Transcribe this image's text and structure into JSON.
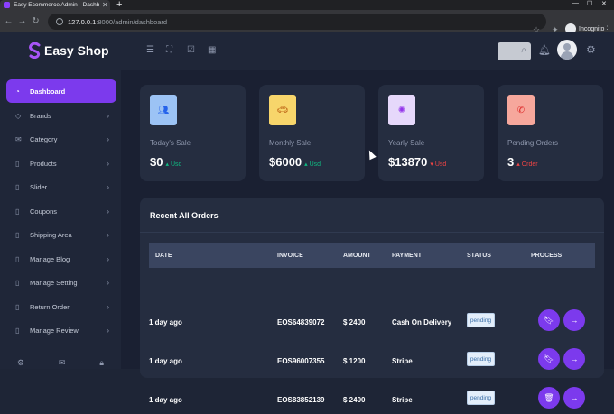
{
  "browser": {
    "tab_title": "Easy Ecommerce Admin - Dashb",
    "tab_close": "✕",
    "new_tab": "+",
    "url_host": "127.0.0.1",
    "url_path": ":8000/admin/dashboard",
    "incognito_label": "Incognito"
  },
  "app": {
    "brand": "Easy Shop",
    "accent": "#7c3aed"
  },
  "topbar_icons": [
    "menu-icon",
    "fullscreen-icon",
    "checkbox-icon",
    "calendar-icon",
    "search-icon",
    "bell-icon",
    "avatar",
    "gear-icon"
  ],
  "sidebar": {
    "items": [
      {
        "label": "Dashboard",
        "icon": "pie-chart-icon",
        "active": true
      },
      {
        "label": "Brands",
        "icon": "tag-icon"
      },
      {
        "label": "Category",
        "icon": "mail-icon"
      },
      {
        "label": "Products",
        "icon": "file-icon"
      },
      {
        "label": "Slider",
        "icon": "file-icon"
      },
      {
        "label": "Coupons",
        "icon": "file-icon"
      },
      {
        "label": "Shipping Area",
        "icon": "file-icon"
      },
      {
        "label": "Manage Blog",
        "icon": "file-icon"
      },
      {
        "label": "Manage Setting",
        "icon": "file-icon"
      },
      {
        "label": "Return Order",
        "icon": "file-icon"
      },
      {
        "label": "Manage Review",
        "icon": "file-icon"
      }
    ]
  },
  "stats": [
    {
      "label": "Today's Sale",
      "value": "$0",
      "trend": "Usd",
      "direction": "up",
      "icon": "users-icon",
      "color": "#9cc3f5"
    },
    {
      "label": "Monthly Sale",
      "value": "$6000",
      "trend": "Usd",
      "direction": "up",
      "icon": "car-icon",
      "color": "#f7d56b"
    },
    {
      "label": "Yearly Sale",
      "value": "$13870",
      "trend": "Usd",
      "direction": "down",
      "icon": "globe-icon",
      "color": "#e6d8fb"
    },
    {
      "label": "Pending Orders",
      "value": "3",
      "trend": "Order",
      "direction": "up",
      "icon": "phone-icon",
      "color": "#f6a79c"
    }
  ],
  "orders": {
    "title": "Recent All Orders",
    "columns": [
      "DATE",
      "INVOICE",
      "AMOUNT",
      "PAYMENT",
      "STATUS",
      "PROCESS"
    ],
    "rows": [
      {
        "date": "1 day ago",
        "invoice": "EOS64839072",
        "amount": "$ 2400",
        "payment": "Cash On Delivery",
        "status": "pending"
      },
      {
        "date": "1 day ago",
        "invoice": "EOS96007355",
        "amount": "$ 1200",
        "payment": "Stripe",
        "status": "pending"
      },
      {
        "date": "1 day ago",
        "invoice": "EOS83852139",
        "amount": "$ 2400",
        "payment": "Stripe",
        "status": "pending"
      }
    ]
  }
}
